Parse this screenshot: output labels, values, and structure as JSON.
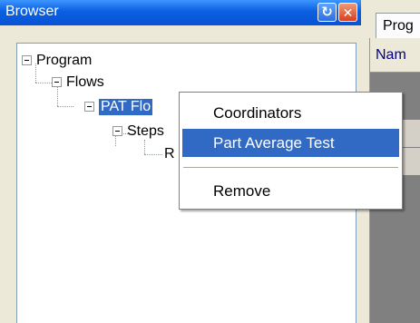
{
  "browser": {
    "title": "Browser",
    "tree": {
      "program": "Program",
      "flows": "Flows",
      "pat_flow": "PAT Flo",
      "steps": "Steps",
      "leaf": "R"
    }
  },
  "main": {
    "tab_label": "Prog",
    "column_header": "Nam"
  },
  "context_menu": {
    "items": [
      {
        "label": "Coordinators"
      },
      {
        "label": "Part Average Test"
      },
      {
        "label": "Remove"
      }
    ],
    "active_item": "Part Average Test"
  },
  "colors": {
    "titlebar": "#0a5fe0",
    "selection": "#316ac5",
    "close_button": "#d9401c"
  }
}
